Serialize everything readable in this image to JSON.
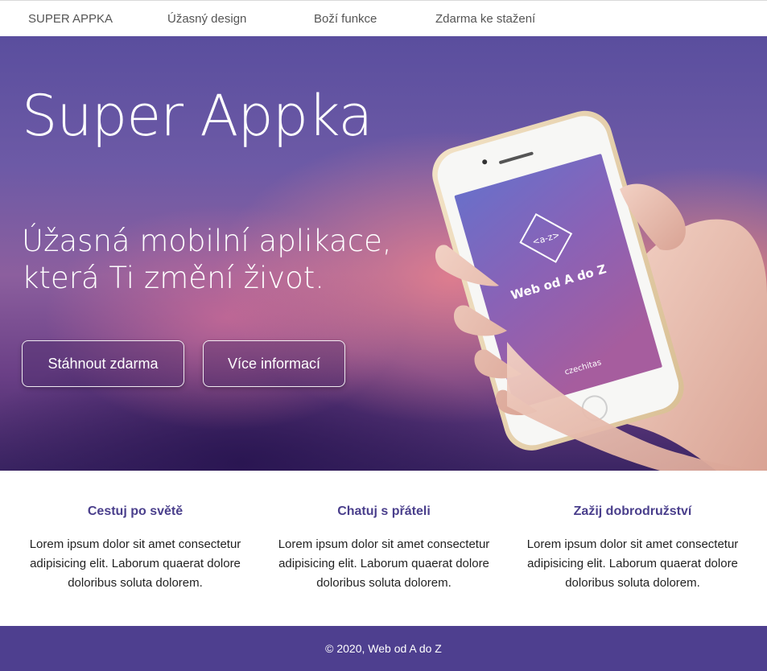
{
  "nav": {
    "brand": "SUPER APPKA",
    "links": [
      "Úžasný design",
      "Boží funkce",
      "Zdarma ke stažení"
    ]
  },
  "hero": {
    "title": "Super Appka",
    "subtitle": "Úžasná mobilní aplikace, která Ti změní život.",
    "buttons": {
      "download": "Stáhnout zdarma",
      "more": "Více informací"
    },
    "phone_screen": {
      "logo_text": "<a-z>",
      "app_name": "Web od A do Z",
      "brand": "czechitas"
    }
  },
  "features": [
    {
      "title": "Cestuj po světě",
      "text": "Lorem ipsum dolor sit amet consectetur adipisicing elit. Laborum quaerat dolore doloribus soluta dolorem."
    },
    {
      "title": "Chatuj s přáteli",
      "text": "Lorem ipsum dolor sit amet consectetur adipisicing elit. Laborum quaerat dolore doloribus soluta dolorem."
    },
    {
      "title": "Zažij dobrodružství",
      "text": "Lorem ipsum dolor sit amet consectetur adipisicing elit. Laborum quaerat dolore doloribus soluta dolorem."
    }
  ],
  "footer": {
    "text": "© 2020, Web od A do Z"
  },
  "colors": {
    "accent": "#4a3f8c",
    "footer_bg": "#4e3f8f",
    "hero_top": "#5a4e9e",
    "hero_bottom": "#3b2563"
  }
}
